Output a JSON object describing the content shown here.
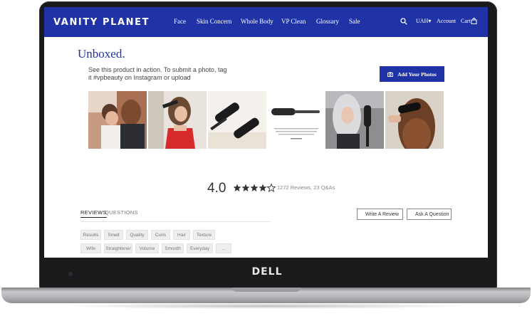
{
  "device": {
    "brand_logo": "DELL"
  },
  "header": {
    "logo": "VANITY PLANET",
    "nav": [
      "Face",
      "Skin Concern",
      "Whole Body",
      "VP Clean",
      "Glossary",
      "Sale"
    ],
    "currency": "UAH▾",
    "account": "Account",
    "cart": "Cart"
  },
  "unboxed": {
    "title": "Unboxed.",
    "description": "See this product in action. To submit a photo, tag it #vpbeauty on Instagram or upload",
    "add_photos_label": "Add Your Photos"
  },
  "rating": {
    "average": "4.0",
    "stars": 4,
    "max_stars": 5,
    "summary": "1272 Reviews, 23 Q&As"
  },
  "tabs": {
    "reviews": "REVIEWS",
    "questions": "QUESTIONS"
  },
  "actions": {
    "write_review": "Write A Review",
    "ask_question": "Ask A Question"
  },
  "tags": {
    "row1": [
      "Results",
      "Smell",
      "Quality",
      "Curls",
      "Hair",
      "Texture"
    ],
    "row2": [
      "Wife",
      "Straightener",
      "Volume",
      "Smooth",
      "Everyday",
      "..."
    ]
  },
  "colors": {
    "brand_blue": "#1f33a6",
    "frame": "#1a1a1c"
  }
}
